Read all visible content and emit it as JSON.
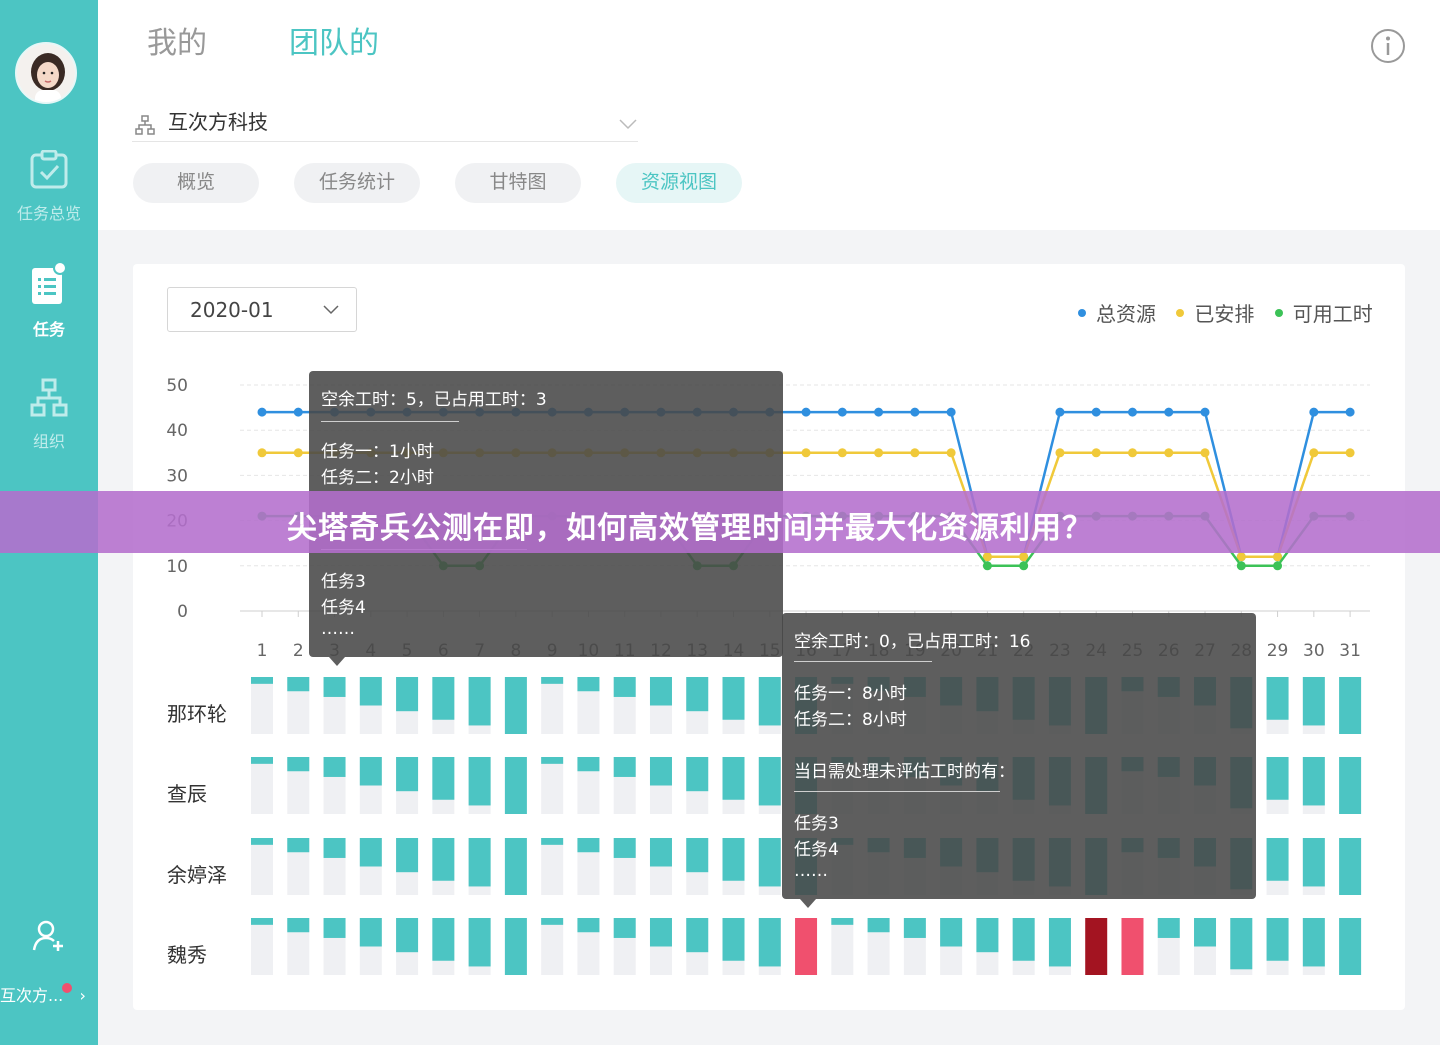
{
  "sidebar": {
    "nav": [
      {
        "label": "任务总览",
        "icon": "clipboard-check-icon",
        "active": false
      },
      {
        "label": "任务",
        "icon": "task-list-icon",
        "active": true
      },
      {
        "label": "组织",
        "icon": "org-tree-icon",
        "active": false
      }
    ],
    "footer_label": "互次方...",
    "add_member_icon": "add-member-icon"
  },
  "header": {
    "tabs": [
      {
        "label": "我的",
        "active": false
      },
      {
        "label": "团队的",
        "active": true
      }
    ],
    "info_icon": "info-icon"
  },
  "org_select": {
    "value": "互次方科技",
    "icon": "org-icon"
  },
  "view_tabs": [
    {
      "label": "概览",
      "active": false
    },
    {
      "label": "任务统计",
      "active": false
    },
    {
      "label": "甘特图",
      "active": false
    },
    {
      "label": "资源视图",
      "active": true
    }
  ],
  "date_select": {
    "value": "2020-01"
  },
  "legend": [
    {
      "label": "总资源",
      "color": "#2f8fdf"
    },
    {
      "label": "已安排",
      "color": "#f0c93a"
    },
    {
      "label": "可用工时",
      "color": "#3cc257"
    }
  ],
  "chart_data": {
    "type": "line",
    "x": [
      1,
      2,
      3,
      4,
      5,
      6,
      7,
      8,
      9,
      10,
      11,
      12,
      13,
      14,
      15,
      16,
      17,
      18,
      19,
      20,
      21,
      22,
      23,
      24,
      25,
      26,
      27,
      28,
      29,
      30,
      31
    ],
    "ylim": [
      0,
      50
    ],
    "yticks": [
      0,
      10,
      20,
      30,
      40,
      50
    ],
    "grid": true,
    "legend_position": "top-right",
    "series": [
      {
        "name": "总资源",
        "color": "#2f8fdf",
        "values": [
          44,
          44,
          44,
          44,
          44,
          44,
          44,
          44,
          44,
          44,
          44,
          44,
          44,
          44,
          44,
          44,
          44,
          44,
          44,
          44,
          12,
          12,
          44,
          44,
          44,
          44,
          44,
          12,
          12,
          44,
          44
        ]
      },
      {
        "name": "已安排",
        "color": "#f0c93a",
        "values": [
          35,
          35,
          35,
          35,
          35,
          35,
          35,
          35,
          35,
          35,
          35,
          35,
          35,
          35,
          35,
          35,
          35,
          35,
          35,
          35,
          12,
          12,
          35,
          35,
          35,
          35,
          35,
          12,
          12,
          35,
          35
        ]
      },
      {
        "name": "可用工时",
        "color": "#3cc257",
        "values": [
          21,
          21,
          21,
          21,
          21,
          10,
          10,
          21,
          21,
          21,
          21,
          21,
          10,
          10,
          21,
          21,
          21,
          21,
          21,
          21,
          10,
          10,
          21,
          21,
          21,
          21,
          21,
          10,
          10,
          21,
          21
        ]
      }
    ]
  },
  "gantt": {
    "people": [
      "那环轮",
      "查辰",
      "余婷泽",
      "魏秀"
    ],
    "load": [
      [
        0.12,
        0.25,
        0.35,
        0.5,
        0.6,
        0.75,
        0.85,
        1.0,
        0.12,
        0.25,
        0.35,
        0.5,
        0.6,
        0.75,
        0.85,
        1.0,
        0.12,
        0.25,
        0.35,
        0.5,
        0.6,
        0.75,
        0.85,
        1.0,
        0.25,
        0.35,
        0.5,
        0.9,
        0.75,
        0.85,
        1.0
      ],
      [
        0.12,
        0.25,
        0.35,
        0.5,
        0.6,
        0.75,
        0.85,
        1.0,
        0.12,
        0.25,
        0.35,
        0.5,
        0.6,
        0.75,
        0.85,
        1.0,
        0.12,
        0.25,
        0.35,
        0.5,
        0.6,
        0.75,
        0.85,
        1.0,
        0.25,
        0.35,
        0.5,
        0.9,
        0.75,
        0.85,
        1.0
      ],
      [
        0.12,
        0.25,
        0.35,
        0.5,
        0.6,
        0.75,
        0.85,
        1.0,
        0.12,
        0.25,
        0.35,
        0.5,
        0.6,
        0.75,
        0.85,
        1.0,
        0.12,
        0.25,
        0.35,
        0.5,
        0.6,
        0.75,
        0.85,
        1.0,
        0.25,
        0.35,
        0.5,
        0.9,
        0.75,
        0.85,
        1.0
      ],
      [
        0.12,
        0.25,
        0.35,
        0.5,
        0.6,
        0.75,
        0.85,
        1.0,
        0.12,
        0.25,
        0.35,
        0.5,
        0.6,
        0.75,
        0.85,
        1.0,
        0.12,
        0.25,
        0.35,
        0.5,
        0.6,
        0.75,
        0.85,
        1.0,
        0.25,
        0.35,
        0.5,
        0.9,
        0.75,
        0.85,
        1.0
      ]
    ],
    "overload": [
      {
        "row": 3,
        "day": 16,
        "color": "#f0506e"
      },
      {
        "row": 3,
        "day": 24,
        "color": "#a31421"
      },
      {
        "row": 3,
        "day": 25,
        "color": "#f0506e"
      }
    ]
  },
  "tooltip1": {
    "summary": "空余工时：5，已占用工时：3",
    "tasks": [
      "任务一：1小时",
      "任务二：2小时"
    ],
    "extra": [
      "任务3",
      "任务4",
      "……"
    ]
  },
  "tooltip2": {
    "summary": "空余工时：0，已占用工时：16",
    "tasks": [
      "任务一：8小时",
      "任务二：8小时"
    ],
    "note": "当日需处理未评估工时的有：",
    "extra": [
      "任务3",
      "任务4",
      "……"
    ]
  },
  "banner": {
    "text": "尖塔奇兵公测在即，如何高效管理时间并最大化资源利用？"
  }
}
